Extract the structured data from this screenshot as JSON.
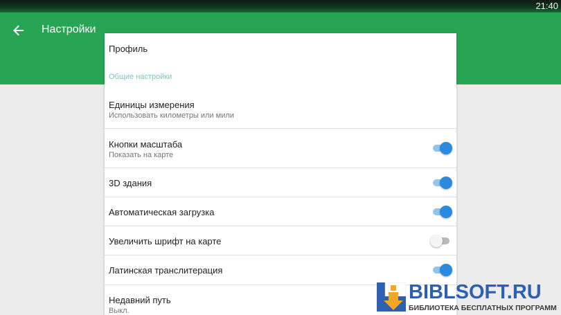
{
  "status_bar": {
    "time": "21:40"
  },
  "app_bar": {
    "title": "Настройки",
    "back_icon": "arrow-left-icon",
    "background_color": "#27a554"
  },
  "settings": {
    "profile": {
      "title": "Профиль"
    },
    "general_section": {
      "header": "Общие настройки"
    },
    "units": {
      "title": "Единицы измерения",
      "subtitle": "Использовать километры или мили"
    },
    "zoom_buttons": {
      "title": "Кнопки масштаба",
      "subtitle": "Показать на карте",
      "enabled": true
    },
    "buildings_3d": {
      "title": "3D здания",
      "enabled": true
    },
    "auto_download": {
      "title": "Автоматическая загрузка",
      "enabled": true
    },
    "large_font": {
      "title": "Увеличить шрифт на карте",
      "enabled": false
    },
    "transliteration": {
      "title": "Латинская транслитерация",
      "enabled": true
    },
    "recent_route": {
      "title": "Недавний путь",
      "subtitle": "Выкл."
    }
  },
  "watermark": {
    "name": "BIBLSOFT.RU",
    "tagline": "БИБЛИОТЕКА БЕСПЛАТНЫХ ПРОГРАММ"
  },
  "colors": {
    "toggle_on": "#2a8ae0",
    "section_header": "#7fc6c0"
  }
}
